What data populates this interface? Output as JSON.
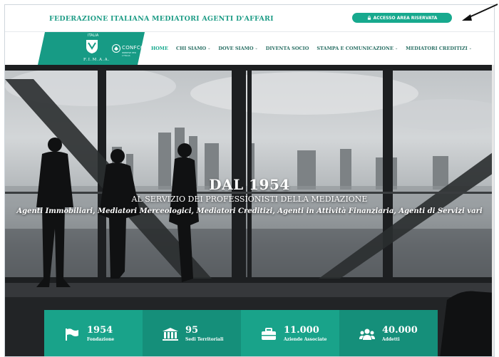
{
  "header": {
    "title": "FEDERAZIONE ITALIANA MEDIATORI AGENTI D'AFFARI",
    "access_button": "ACCESSO AREA RISERVATA",
    "icons": {
      "access": "lock-icon",
      "annotation": "arrow-pointer-icon"
    }
  },
  "logo": {
    "italia": "ITALIA",
    "fimaa": "F.I.M.A.A.",
    "partner": "CONFCOMMERCIO",
    "partner_sub": "IMPRESE PER L'ITALIA"
  },
  "nav": {
    "items": [
      {
        "label": "HOME",
        "active": true,
        "dropdown": false
      },
      {
        "label": "CHI SIAMO",
        "active": false,
        "dropdown": true
      },
      {
        "label": "DOVE SIAMO",
        "active": false,
        "dropdown": true
      },
      {
        "label": "DIVENTA SOCIO",
        "active": false,
        "dropdown": false
      },
      {
        "label": "STAMPA E COMUNICAZIONE",
        "active": false,
        "dropdown": true
      },
      {
        "label": "MEDIATORI CREDITIZI",
        "active": false,
        "dropdown": true
      }
    ],
    "chevron": "⌄"
  },
  "hero": {
    "line1": "DAL 1954",
    "line2": "AL SERVIZIO DEI PROFESSIONISTI DELLA MEDIAZIONE",
    "line3": "Agenti Immobiliari, Mediatori Merceologici, Mediatori Creditizi, Agenti in Attività Finanziaria, Agenti di Servizi vari"
  },
  "stats": [
    {
      "value": "1954",
      "label": "Fondazione",
      "icon": "flag-icon"
    },
    {
      "value": "95",
      "label": "Sedi Territoriali",
      "icon": "building-icon"
    },
    {
      "value": "11.000",
      "label": "Aziende Associate",
      "icon": "briefcase-icon"
    },
    {
      "value": "40.000",
      "label": "Addetti",
      "icon": "users-icon"
    }
  ],
  "colors": {
    "brand": "#17a98e",
    "brand_dark": "#158f7a",
    "title_text": "#1e9c86"
  }
}
